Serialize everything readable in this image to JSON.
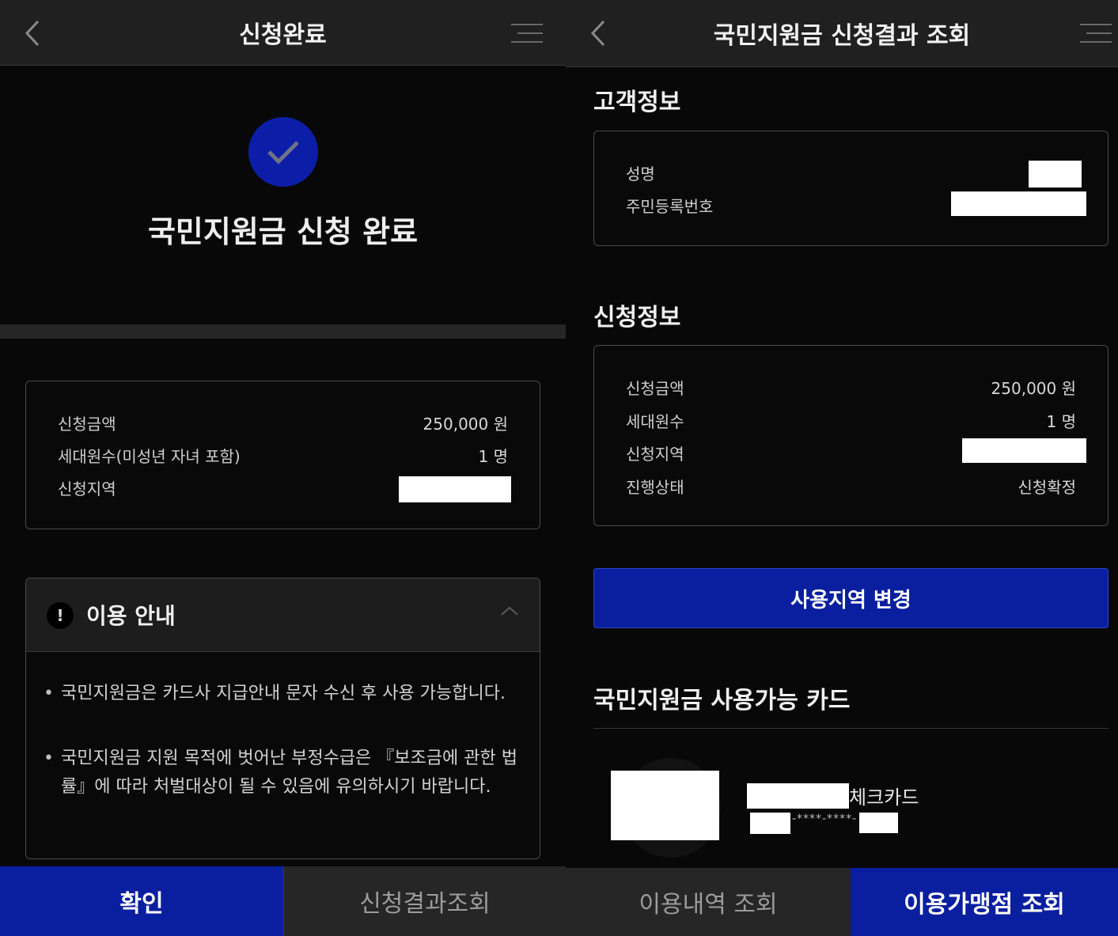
{
  "left": {
    "title": "신청완료",
    "done_message": "국민지원금 신청 완료",
    "summary": [
      {
        "label": "신청금액",
        "value": "250,000 원"
      },
      {
        "label": "세대원수(미성년 자녀 포함)",
        "value": "1 명"
      },
      {
        "label": "신청지역",
        "value": ""
      }
    ],
    "notice": {
      "title": "이용 안내",
      "items": [
        "국민지원금은 카드사 지급안내 문자 수신 후 사용 가능합니다.",
        "국민지원금 지원 목적에 벗어난 부정수급은 『보조금에 관한 법률』에 따라 처벌대상이 될 수 있음에 유의하시기 바랍니다."
      ]
    },
    "buttons": {
      "confirm": "확인",
      "result": "신청결과조회"
    }
  },
  "right": {
    "title": "국민지원금 신청결과 조회",
    "customer_section": "고객정보",
    "customer": [
      {
        "label": "성명",
        "value": ""
      },
      {
        "label": "주민등록번호",
        "value": ""
      }
    ],
    "application_section": "신청정보",
    "application": [
      {
        "label": "신청금액",
        "value": "250,000 원"
      },
      {
        "label": "세대원수",
        "value": "1 명"
      },
      {
        "label": "신청지역",
        "value": ""
      },
      {
        "label": "진행상태",
        "value": "신청확정"
      }
    ],
    "change_button": "사용지역 변경",
    "card_section": "국민지원금 사용가능 카드",
    "card": {
      "name_suffix": "체크카드",
      "number_mask": "-****-****-"
    },
    "buttons": {
      "history": "이용내역 조회",
      "stores": "이용가맹점 조회"
    }
  },
  "colors": {
    "brand_blue": "#0a1fa0",
    "background": "#080808",
    "topbar": "#202020"
  },
  "icons": {
    "back": "chevron-left-icon",
    "menu": "menu-icon",
    "check": "check-icon",
    "notice": "exclamation-icon",
    "collapse": "chevron-up-icon"
  }
}
